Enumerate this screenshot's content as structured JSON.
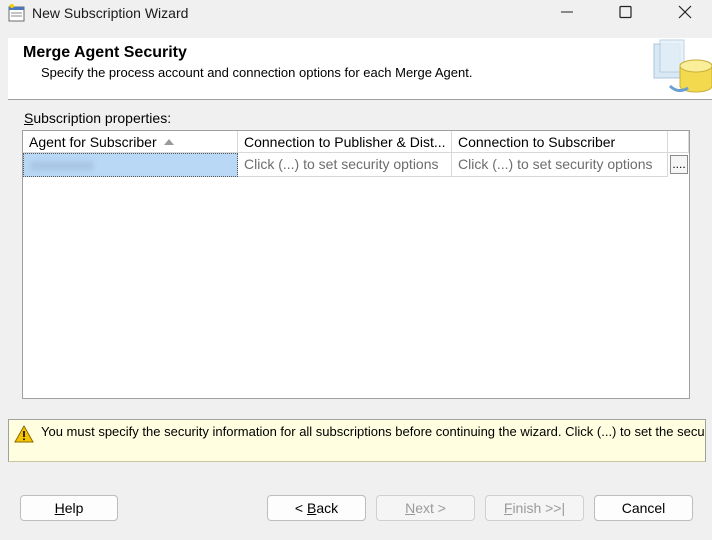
{
  "window": {
    "title": "New Subscription Wizard"
  },
  "header": {
    "title": "Merge Agent Security",
    "subtitle": "Specify the process account and connection options for each Merge Agent."
  },
  "properties": {
    "label_prefix": "S",
    "label_rest": "ubscription properties:",
    "columns": [
      "Agent for Subscriber",
      "Connection to Publisher & Dist...",
      "Connection to Subscriber"
    ],
    "rows": [
      {
        "agent": "",
        "publisher_conn": "Click (...) to set security options",
        "subscriber_conn": "Click (...) to set security options",
        "button": "...."
      }
    ]
  },
  "warning": {
    "text": "You must specify the security information for all subscriptions before continuing the wizard. Click (...) to set the secu"
  },
  "buttons": {
    "help": {
      "u": "H",
      "rest": "elp"
    },
    "back": {
      "pre": "< ",
      "u": "B",
      "rest": "ack"
    },
    "next": {
      "u": "N",
      "rest": "ext >"
    },
    "finish": {
      "u": "F",
      "rest": "inish >>|"
    },
    "cancel": "Cancel"
  }
}
